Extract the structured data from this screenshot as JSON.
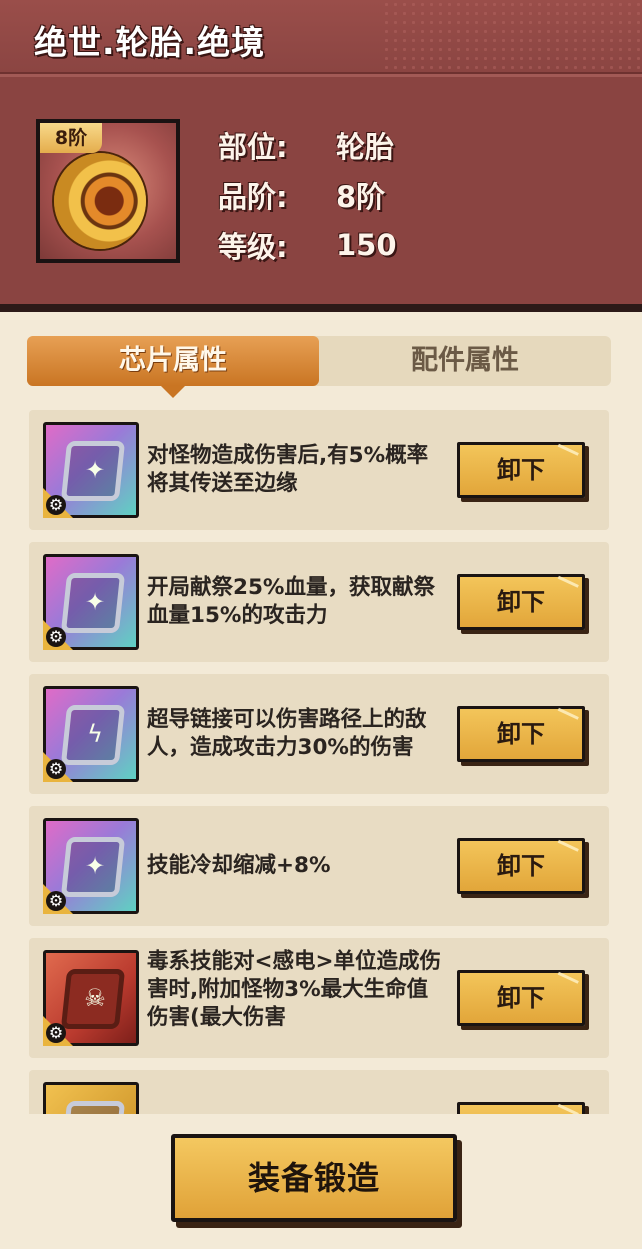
{
  "header": {
    "title": "绝世.轮胎.绝境",
    "tier_badge": "8阶",
    "item_icon": "tire-icon",
    "attributes": [
      {
        "key": "部位:",
        "value": "轮胎"
      },
      {
        "key": "品阶:",
        "value": "8阶"
      },
      {
        "key": "等级:",
        "value": "150"
      }
    ]
  },
  "tabs": [
    {
      "label": "芯片属性",
      "active": true
    },
    {
      "label": "配件属性",
      "active": false
    }
  ],
  "chips": [
    {
      "icon": "purple-chip-icon",
      "glyph": "✦",
      "desc": "对怪物造成伤害后,有5%概率将其传送至边缘",
      "button": "卸下"
    },
    {
      "icon": "purple-chip-icon",
      "glyph": "✦",
      "desc": "开局献祭25%血量，获取献祭血量15%的攻击力",
      "button": "卸下"
    },
    {
      "icon": "purple-chip-icon",
      "glyph": "ϟ",
      "desc": "超导链接可以伤害路径上的敌人，造成攻击力30%的伤害",
      "button": "卸下"
    },
    {
      "icon": "purple-chip-icon",
      "glyph": "✦",
      "desc": "技能冷却缩减+8%",
      "button": "卸下"
    },
    {
      "icon": "red-skull-chip-icon",
      "glyph": "☠",
      "desc": "毒系技能对<感电>单位造成伤害时,附加怪物3%最大生命值伤害(最大伤害",
      "button": "卸下"
    }
  ],
  "forge_button": "装备锻造",
  "colors": {
    "header_bg": "#8a4441",
    "panel_bg": "#f3ead7",
    "row_bg": "#e8dcc3",
    "button_gold": "#e2a63a",
    "tab_active": "#c97523"
  }
}
